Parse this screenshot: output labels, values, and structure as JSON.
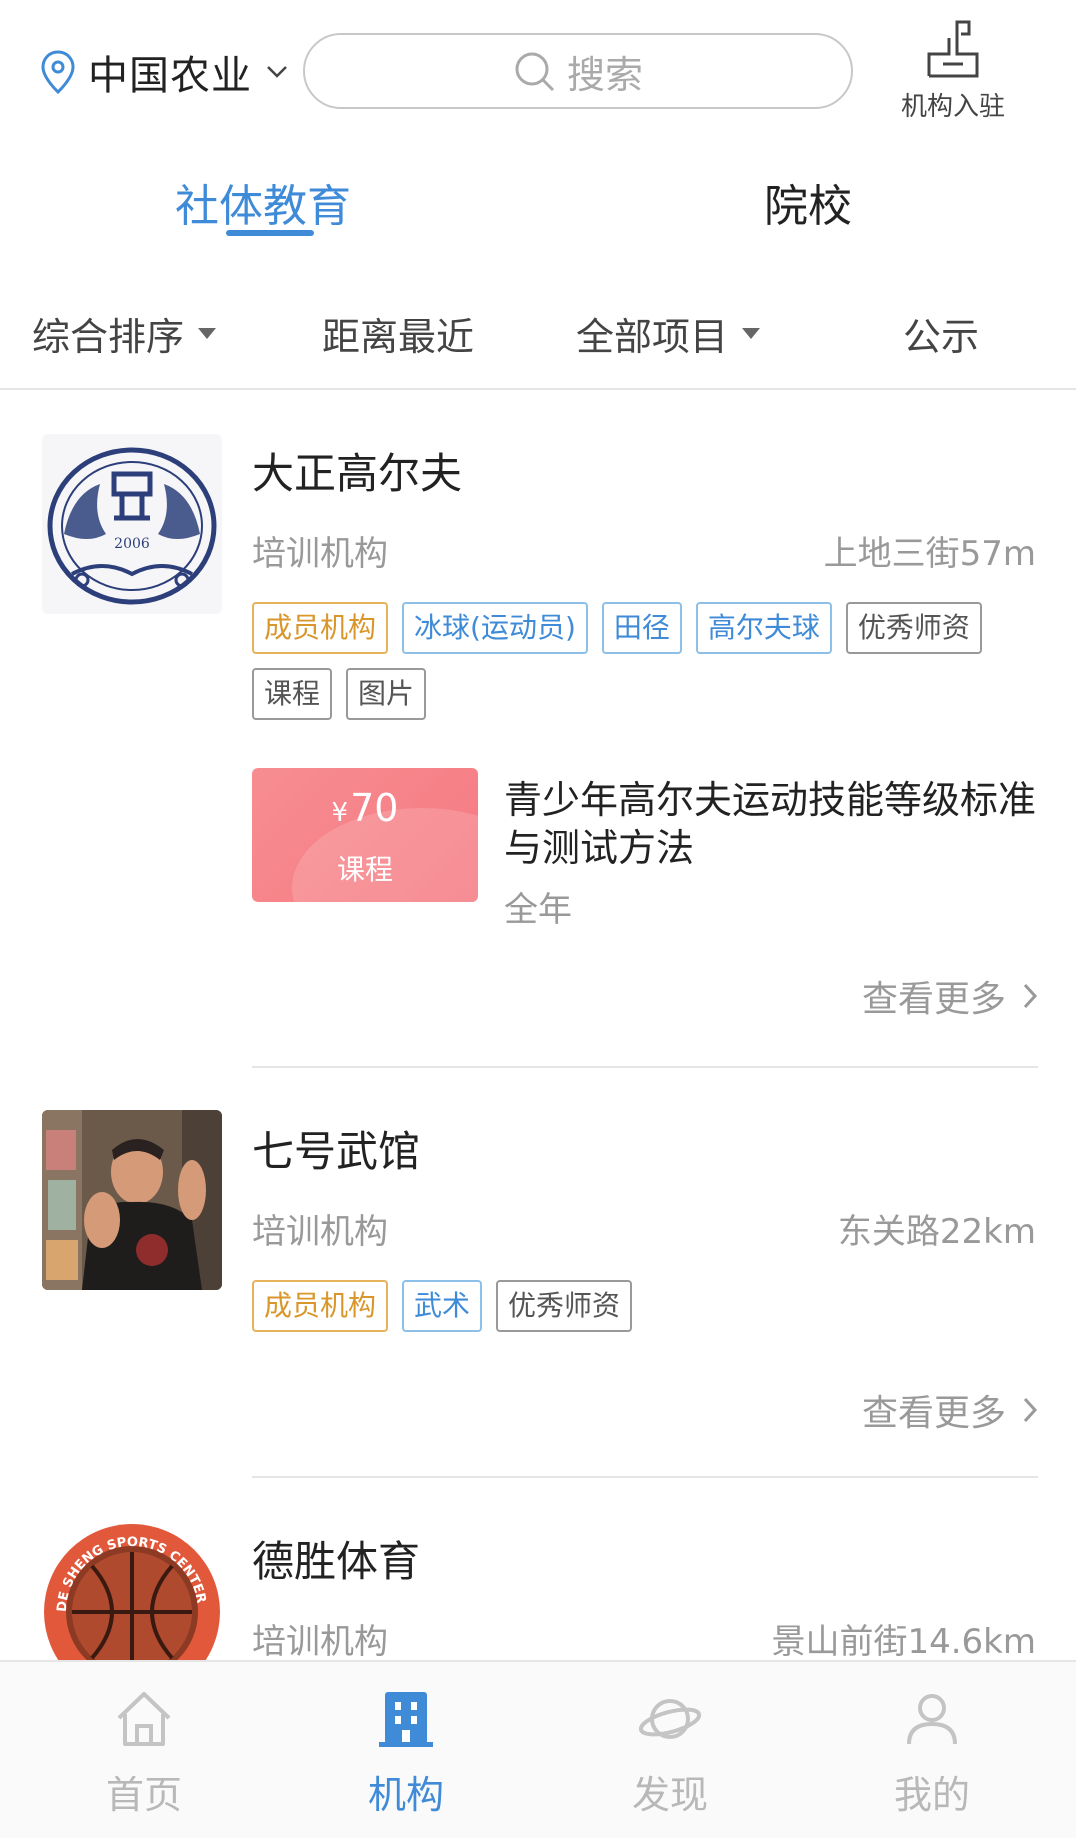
{
  "header": {
    "location": "中国农业",
    "search_placeholder": "搜索",
    "join_label": "机构入驻"
  },
  "main_tabs": [
    {
      "label": "社体教育",
      "active": true
    },
    {
      "label": "院校",
      "active": false
    }
  ],
  "filters": [
    {
      "label": "综合排序",
      "dropdown": true
    },
    {
      "label": "距离最近",
      "dropdown": false
    },
    {
      "label": "全部项目",
      "dropdown": true
    },
    {
      "label": "公示",
      "dropdown": false
    }
  ],
  "listings": [
    {
      "name": "大正高尔夫",
      "type": "培训机构",
      "distance": "上地三街57m",
      "logo_text": "2006",
      "tags": [
        {
          "label": "成员机构",
          "style": "gold"
        },
        {
          "label": "冰球(运动员)",
          "style": "blue"
        },
        {
          "label": "田径",
          "style": "blue"
        },
        {
          "label": "高尔夫球",
          "style": "blue"
        },
        {
          "label": "优秀师资",
          "style": "gray"
        },
        {
          "label": "课程",
          "style": "gray"
        },
        {
          "label": "图片",
          "style": "gray"
        }
      ],
      "course": {
        "currency": "¥",
        "price": "70",
        "type": "课程",
        "name": "青少年高尔夫运动技能等级标准与测试方法",
        "period": "全年"
      },
      "more_label": "查看更多"
    },
    {
      "name": "七号武馆",
      "type": "培训机构",
      "distance": "东关路22km",
      "tags": [
        {
          "label": "成员机构",
          "style": "gold"
        },
        {
          "label": "武术",
          "style": "blue"
        },
        {
          "label": "优秀师资",
          "style": "gray"
        }
      ],
      "more_label": "查看更多"
    },
    {
      "name": "德胜体育",
      "type": "培训机构",
      "distance": "景山前街14.6km",
      "logo_text": "DE SHENG SPORTS CENTER"
    }
  ],
  "bottom_nav": [
    {
      "label": "首页",
      "icon": "home-icon",
      "active": false
    },
    {
      "label": "机构",
      "icon": "building-icon",
      "active": true
    },
    {
      "label": "发现",
      "icon": "planet-icon",
      "active": false
    },
    {
      "label": "我的",
      "icon": "user-icon",
      "active": false
    }
  ],
  "colors": {
    "accent": "#3f8bd8",
    "gold_tag": "#d9962b",
    "ticket": "#f57a82",
    "muted": "#999999"
  }
}
